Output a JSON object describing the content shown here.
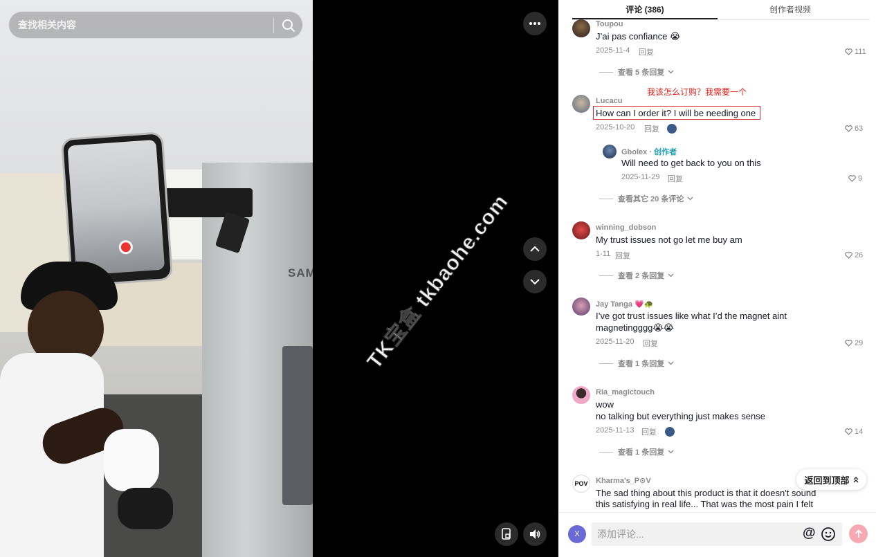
{
  "search": {
    "placeholder": "查找相关内容"
  },
  "watermark": "TK宝盒 tkbaohe.com",
  "scene": {
    "fridge_brand": "SAMS"
  },
  "tabs": [
    {
      "label": "评论 (386)",
      "active": true
    },
    {
      "label": "创作者视频",
      "active": false
    }
  ],
  "annotation": {
    "translation": "我该怎么订购？我需要一个"
  },
  "comments": [
    {
      "user": "Toupou",
      "lines": [
        "J’ai pas confiance 😭"
      ],
      "date": "2025-11-4",
      "reply": "回复",
      "likes": "111",
      "view_more": "查看 5 条回复"
    },
    {
      "user": "Lucacu",
      "lines": [
        "How can I order it? I will be needing one"
      ],
      "date": "2025-10-20",
      "reply": "回复",
      "likes": "63",
      "sub_reply": {
        "user": "Gbolex",
        "tag": "创作者",
        "text": "Will need to get back to you on this",
        "date": "2025-11-29",
        "reply": "回复",
        "likes": "9"
      },
      "view_more": "查看其它 20 条评论"
    },
    {
      "user": "winning_dobson",
      "lines": [
        "My trust issues not go let me buy am"
      ],
      "date": "1-11",
      "reply": "回复",
      "likes": "26",
      "view_more": "查看 2 条回复"
    },
    {
      "user": "Jay Tanga 💗🐢",
      "lines": [
        "I’ve got trust issues like what I’d the magnet aint",
        "magnetingggg😭😭"
      ],
      "date": "2025-11-20",
      "reply": "回复",
      "likes": "29",
      "view_more": "查看 1 条回复"
    },
    {
      "user": "Ria_magictouch",
      "lines": [
        "wow",
        "no talking but everything just makes sense"
      ],
      "date": "2025-11-13",
      "reply": "回复",
      "likes": "14",
      "view_more": "查看 1 条回复"
    },
    {
      "user": "Kharma's_P⊙V",
      "lines": [
        "The sad thing about this product is that it doesn't sound",
        "this satisfying in real life... That was the most pain I felt"
      ]
    }
  ],
  "back_to_top": "返回到顶部",
  "composer": {
    "avatar_letter": "X",
    "placeholder": "添加评论...",
    "at": "@"
  },
  "colors": {
    "accent": "#fe2c55",
    "annotation": "#e0221b",
    "creator_tag": "#1da1b2"
  }
}
